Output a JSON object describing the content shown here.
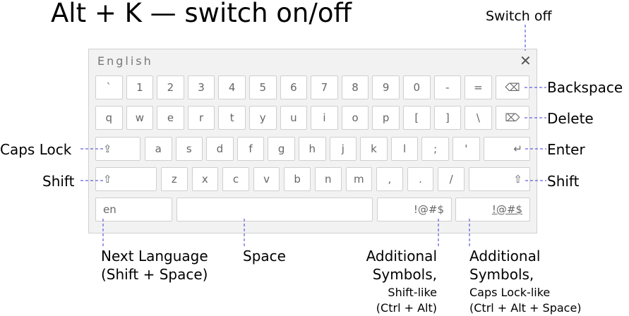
{
  "title": "Alt + K — switch on/off",
  "keyboard": {
    "language_label": "English",
    "close_glyph": "✕",
    "rows": [
      [
        "`",
        "1",
        "2",
        "3",
        "4",
        "5",
        "6",
        "7",
        "8",
        "9",
        "0",
        "-",
        "="
      ],
      [
        "q",
        "w",
        "e",
        "r",
        "t",
        "y",
        "u",
        "i",
        "o",
        "p",
        "[",
        "]",
        "\\"
      ],
      [
        "a",
        "s",
        "d",
        "f",
        "g",
        "h",
        "j",
        "k",
        "l",
        ";",
        "'"
      ],
      [
        "z",
        "x",
        "c",
        "v",
        "b",
        "n",
        "m",
        ",",
        ".",
        "/"
      ]
    ],
    "backspace_glyph": "⌫",
    "delete_glyph": "⌦",
    "capslock_glyph": "⇪",
    "enter_glyph": "↵",
    "shift_glyph": "⇧",
    "lang_key": "en",
    "space_key": "",
    "symbols_key": "!@#$",
    "symbols_lock_key": "!@#$"
  },
  "callouts": {
    "switch_off": "Switch off",
    "backspace": "Backspace",
    "delete": "Delete",
    "enter": "Enter",
    "shift_right": "Shift",
    "caps_lock": "Caps Lock",
    "shift_left": "Shift",
    "next_language_1": "Next Language",
    "next_language_2": "(Shift + Space)",
    "space": "Space",
    "symbols_shift_1": "Additional",
    "symbols_shift_2": "Symbols,",
    "symbols_shift_3": "Shift-like",
    "symbols_shift_4": "(Ctrl + Alt)",
    "symbols_caps_1": "Additional",
    "symbols_caps_2": "Symbols,",
    "symbols_caps_3": "Caps Lock-like",
    "symbols_caps_4": "(Ctrl + Alt + Space)"
  },
  "colors": {
    "leader_line": "#3b3bd6",
    "key_border": "#cfcfcf",
    "panel": "#f2f2f2"
  }
}
